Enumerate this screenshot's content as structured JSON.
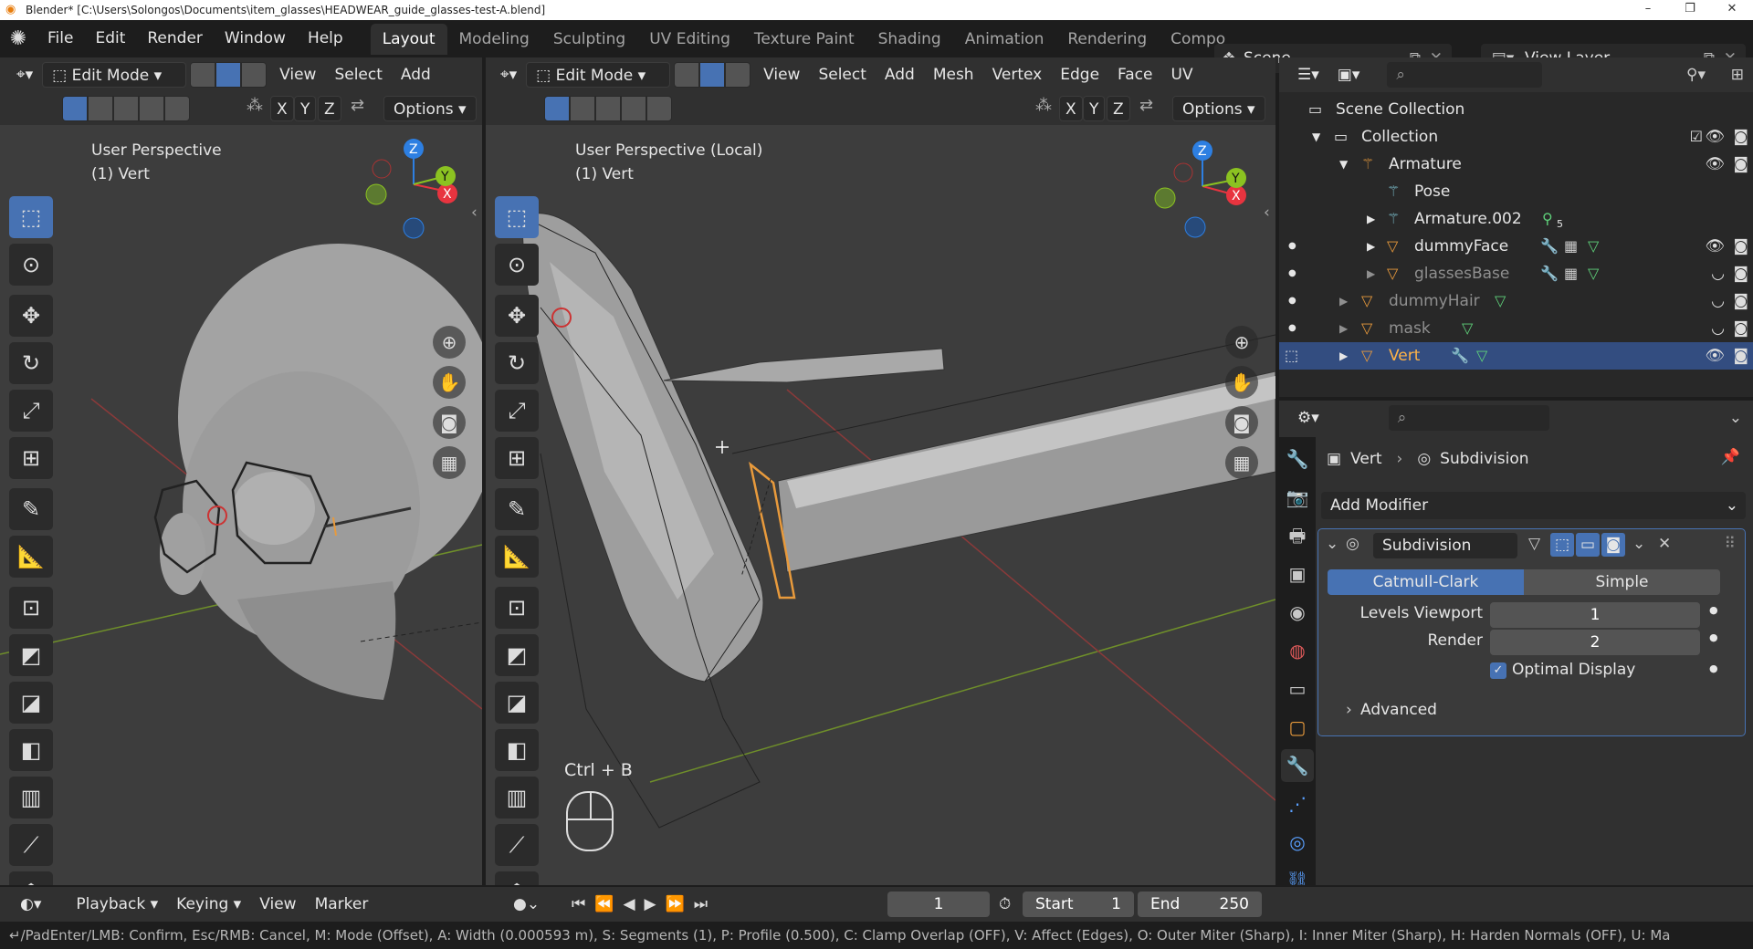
{
  "window": {
    "title": "Blender* [C:\\Users\\Solongos\\Documents\\item_glasses\\HEADWEAR_guide_glasses-test-A.blend]",
    "min": "–",
    "max": "❐",
    "close": "✕"
  },
  "topbar": {
    "menus": [
      "File",
      "Edit",
      "Render",
      "Window",
      "Help"
    ],
    "tabs": [
      "Layout",
      "Modeling",
      "Sculpting",
      "UV Editing",
      "Texture Paint",
      "Shading",
      "Animation",
      "Rendering",
      "Compo"
    ],
    "active_tab": "Layout",
    "scene": "Scene",
    "view_layer": "View Layer"
  },
  "left_viewport": {
    "mode": "Edit Mode",
    "menus": [
      "View",
      "Select",
      "Add"
    ],
    "axes": [
      "X",
      "Y",
      "Z"
    ],
    "options": "Options",
    "info_line1": "User Perspective",
    "info_line2": "(1) Vert"
  },
  "right_viewport": {
    "mode": "Edit Mode",
    "menus": [
      "View",
      "Select",
      "Add",
      "Mesh",
      "Vertex",
      "Edge",
      "Face",
      "UV"
    ],
    "axes": [
      "X",
      "Y",
      "Z"
    ],
    "options": "Options",
    "info_line1": "User Perspective (Local)",
    "info_line2": "(1) Vert",
    "shortcut": "Ctrl + B"
  },
  "gizmo": {
    "x": "X",
    "y": "Y",
    "z": "Z"
  },
  "outliner": {
    "scene_collection": "Scene Collection",
    "rows": [
      {
        "name": "Collection",
        "icon": "collection-icon"
      },
      {
        "name": "Armature",
        "icon": "armature-icon"
      },
      {
        "name": "Pose",
        "icon": "pose-icon"
      },
      {
        "name": "Armature.002",
        "icon": "armature-icon",
        "badge": "5"
      },
      {
        "name": "dummyFace",
        "icon": "mesh-icon"
      },
      {
        "name": "glassesBase",
        "icon": "mesh-icon"
      },
      {
        "name": "dummyHair",
        "icon": "mesh-icon"
      },
      {
        "name": "mask",
        "icon": "mesh-icon"
      },
      {
        "name": "Vert",
        "icon": "mesh-icon"
      }
    ]
  },
  "properties": {
    "breadcrumb_object": "Vert",
    "breadcrumb_modifier": "Subdivision",
    "add_modifier": "Add Modifier",
    "modifier_name": "Subdivision",
    "catmull": "Catmull-Clark",
    "simple": "Simple",
    "levels_viewport_label": "Levels Viewport",
    "levels_viewport_value": "1",
    "render_label": "Render",
    "render_value": "2",
    "optimal_display": "Optimal Display",
    "advanced": "Advanced"
  },
  "timeline": {
    "menus": [
      "Playback",
      "Keying",
      "View",
      "Marker"
    ],
    "current_frame": "1",
    "start_label": "Start",
    "start_value": "1",
    "end_label": "End",
    "end_value": "250"
  },
  "status": "↵/PadEnter/LMB: Confirm, Esc/RMB: Cancel, M: Mode (Offset), A: Width (0.000593 m), S: Segments (1), P: Profile (0.500), C: Clamp Overlap (OFF), V: Affect (Edges), O: Outer Miter (Sharp), I: Inner Miter (Sharp), H: Harden Normals (OFF), U: Ma",
  "colors": {
    "accent": "#4772b3",
    "selected_row": "#334d80",
    "x_axis": "#e8343f",
    "y_axis": "#8bc221",
    "z_axis": "#2d7fe2",
    "edit_orange": "#e89a3c"
  }
}
